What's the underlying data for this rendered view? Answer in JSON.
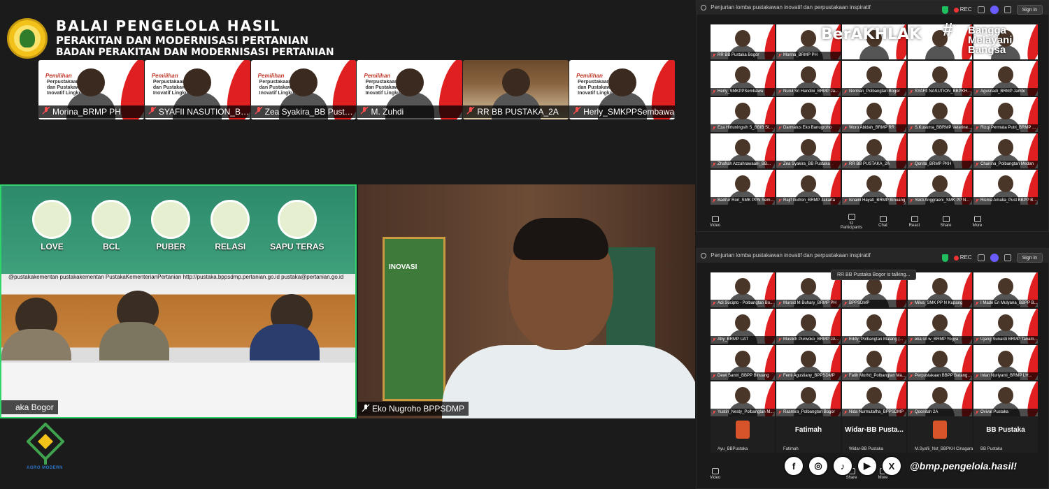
{
  "header": {
    "line1": "BALAI PENGELOLA HASIL",
    "line2": "PERAKITAN DAN MODERNISASI PERTANIAN",
    "line3": "BADAN PERAKITAN DAN MODERNISASI PERTANIAN"
  },
  "top_strip": [
    {
      "name": "Morina_BRMP PH",
      "kind": "banner"
    },
    {
      "name": "SYAFII NASUTION_BBP...",
      "kind": "banner"
    },
    {
      "name": "Zea Syakira_BB Pustaka",
      "kind": "banner"
    },
    {
      "name": "M. Zuhdi",
      "kind": "banner"
    },
    {
      "name": "RR BB PUSTAKA_2A",
      "kind": "photo"
    },
    {
      "name": "Herly_SMKPPSembawa",
      "kind": "banner"
    }
  ],
  "strip_banner": {
    "title": "Pemilihan",
    "subtitle": "Perpustakaan Inspiratif dan Pustakawan Inovatif Lingkup Kementerian Pertanian"
  },
  "room": {
    "label": "aka Bogor",
    "banner_items": [
      "LOVE",
      "BCL",
      "PUBER",
      "RELASI",
      "SAPU TERAS"
    ],
    "banner_url": "@pustakakementan   pustakakementan   PustakaKementerianPertanian   http://pustaka.bppsdmp.pertanian.go.id   pustaka@pertanian.go.id"
  },
  "speaker": {
    "label": "Eko Nugroho BPPSDMP",
    "poster_text": "INOVASI"
  },
  "agro_logo_text": "AGRO MODERN",
  "zoom_top": {
    "title": "Penjurian lomba pustakawan inovatif dan perpustakaan inspiratif",
    "rec": "REC",
    "signin": "Sign in",
    "overlay_left": "BerAKHLAK",
    "overlay_right": [
      "Bangga",
      "Melayani",
      "Bangsa"
    ],
    "participants": [
      "RR BB Pustaka Bogor",
      "Morina_BRMP PH",
      "",
      "",
      "",
      "Herly_SMKPPSembawa",
      "Nurul Sri Handini_BRMP Ja...",
      "Norman_Polbangtan Bogor",
      "SYAFII NASUTION_BBPKH Ci...",
      "Agusnadi_BRMP Jambi",
      "Eza Hirtuningsih S_BBIB Sing...",
      "Darmatus Eko Banugroho",
      "Woro Abidah_BRMP RR",
      "S.Kusuma_BBRMP Veteriner...",
      "Rizqi Permata Putri_BRMP Ja...",
      "Zhafrah Azzahrawaani_BB...",
      "Zea Syakira_BB Pustaka",
      "RR BB PUSTAKA_2A",
      "Qonita_BRMP PKH",
      "Chairina_Polbangtan Medan",
      "Badi'ur Rori_SMK PPN Sem...",
      "Rajif Gufron_BRMP Jakarta",
      "Isnaini Hayati_BRMP Binuang",
      "Yekti Anggraeni_SMK PP N...",
      "Risma Amalia_Pust BBPP Bin..."
    ],
    "toolbar": [
      {
        "label": "Video",
        "count": ""
      },
      {
        "label": "Participants",
        "count": "52"
      },
      {
        "label": "Chat",
        "count": ""
      },
      {
        "label": "React",
        "count": ""
      },
      {
        "label": "Share",
        "count": ""
      },
      {
        "label": "More",
        "count": ""
      }
    ]
  },
  "zoom_bot": {
    "title": "Penjurian lomba pustakawan inovatif dan perpustakaan inspiratif",
    "rec": "REC",
    "signin": "Sign in",
    "talking": "RR BB Pustaka Bogor is talking...",
    "participants": [
      "Adi Sucipto - Polbangtan Bo...",
      "Mursid M Buhary_BRMP PH",
      "BPPSDMP",
      "Milva_SMK PP N Kupang",
      "I Made Eri Mulyana_BBPP B...",
      "Aby_BRMP UAT",
      "Muslich Purwoko_BRMP JAT...",
      "Eddy_Polbangtan Malang (...",
      "eka sri w_BRMP Yogya",
      "Ujang Sunardi BRMP Tanam...",
      "Dewi Santri_BBPP Binuang",
      "Fenti Agustiany_BPPSDMP",
      "Fatih Murhd_Polbangtan Ma...",
      "Perpustakaan BBPP Batangk...",
      "Intan Nuriyanti_BRMP LH...",
      "Yustin_Nesty_Polbangtan M...",
      "Rasmira_Polbangtan Bogor",
      "Nida Nurmutafha_BPPSDMP",
      "Qoonitah 2A",
      "Ovival Pustaka"
    ],
    "bottom_row": [
      {
        "big": "",
        "name": "Ayu_BBPustaka"
      },
      {
        "big": "Fatimah",
        "name": "Fatimah"
      },
      {
        "big": "Widar-BB  Pusta...",
        "name": "Widar-BB Pustaka"
      },
      {
        "big": "",
        "name": "M.Syafii_Nst_BBPKH Cinagara"
      },
      {
        "big": "BB Pustaka",
        "name": "BB Pustaka"
      }
    ],
    "toolbar": [
      {
        "label": "Video"
      },
      {
        "label": "Share"
      },
      {
        "label": "More"
      }
    ]
  },
  "social": {
    "icons": [
      "facebook-icon",
      "instagram-icon",
      "tiktok-icon",
      "youtube-icon",
      "x-icon"
    ],
    "handle": "@bmp.pengelola.hasil!"
  }
}
